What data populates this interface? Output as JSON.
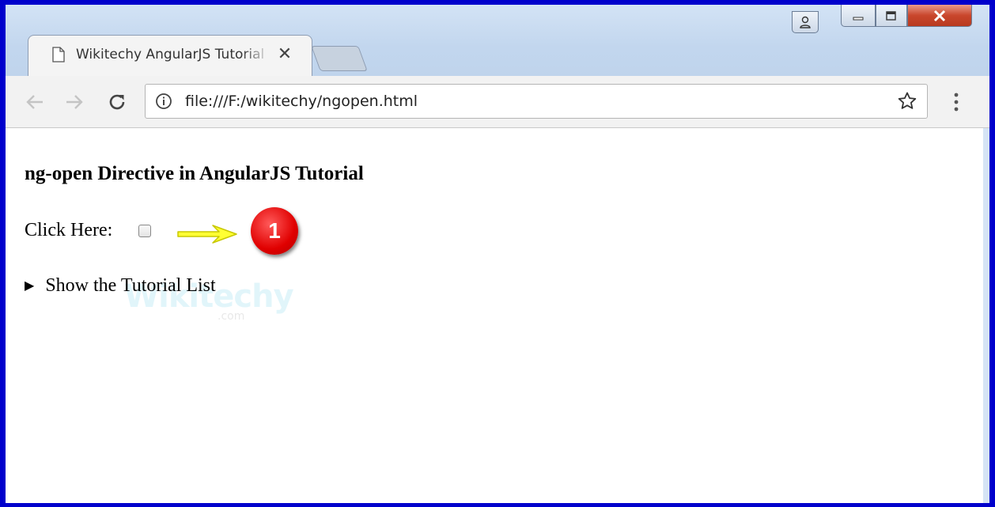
{
  "tab": {
    "title": "Wikitechy AngularJS Tutorial",
    "close_glyph": "✕"
  },
  "address_bar": {
    "url": "file:///F:/wikitechy/ngopen.html"
  },
  "page": {
    "heading": "ng-open Directive in AngularJS Tutorial",
    "checkbox_label": "Click Here:",
    "checkbox_checked": false,
    "summary_marker": "▶",
    "summary_text": "Show the Tutorial List",
    "annotation_number": "1",
    "watermark_text": "Wikitechy",
    "watermark_sub": ".com"
  },
  "icons": {
    "tab": "page-icon",
    "nav": [
      "back-arrow-icon",
      "forward-arrow-icon",
      "reload-icon"
    ],
    "omnibox": [
      "info-icon",
      "star-icon"
    ],
    "menu": "vertical-dots-icon",
    "window": [
      "user-icon",
      "minimize-icon",
      "maximize-icon",
      "close-icon"
    ]
  },
  "colors": {
    "annotation_badge": "#e00000",
    "annotation_arrow": "#ffff00",
    "window_frame": "#0000cc"
  }
}
